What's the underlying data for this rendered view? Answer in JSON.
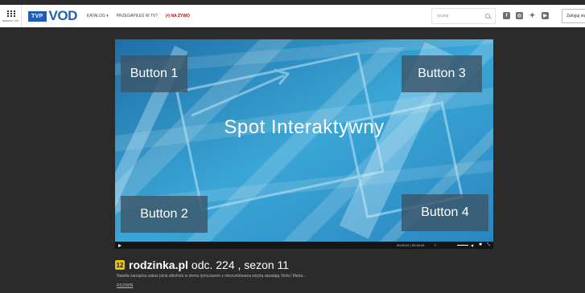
{
  "header": {
    "grid_caption": "SERWISY TVP",
    "logo_tvp": "TVP",
    "logo_vod": "VOD",
    "nav": {
      "katalog": "KATALOG",
      "przegapiles": "PRZEGAPIŁEŚ W TV?",
      "na_zywo": "(•) NA ŻYWO"
    },
    "search_placeholder": "szukaj",
    "social": [
      "facebook-icon",
      "instagram-icon",
      "twitter-icon",
      "youtube-icon"
    ],
    "login_label": "Zaloguj się"
  },
  "player": {
    "button1": "Button 1",
    "button2": "Button 2",
    "button3": "Button 3",
    "button4": "Button 4",
    "center_title": "Spot Interaktywny",
    "time": "00:00:02 | 00:00:20"
  },
  "episode": {
    "age_rating": "12",
    "show_name": "rodzinka.pl",
    "episode_info": "odc. 224 , sezon 11",
    "description": "Natalia zarządza zakaz picia alkoholu w domu tymczasem z nieoczekiwaną wizytą wpadają Viola i Maria...",
    "expand_label": "ROZWIŃ"
  },
  "colors": {
    "brand_blue": "#1f5fb6",
    "live_red": "#e00000",
    "player_blue": "#2f96c8",
    "badge_yellow": "#e8c21b"
  }
}
